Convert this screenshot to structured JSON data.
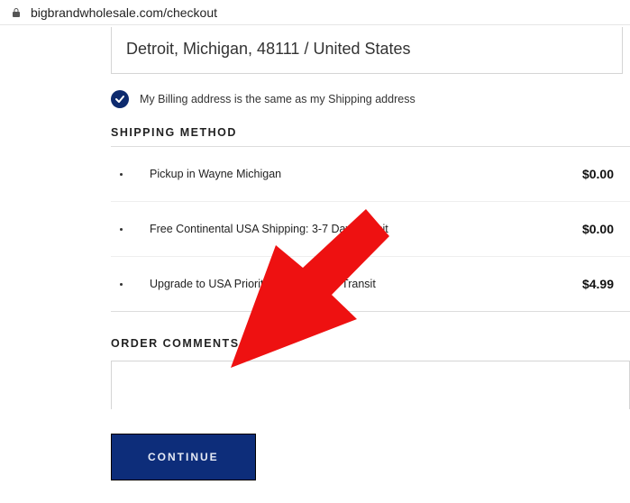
{
  "url": "bigbrandwholesale.com/checkout",
  "address_line": "Detroit, Michigan, 48111 / United States",
  "billing_same_label": "My Billing address is the same as my Shipping address",
  "shipping_heading": "SHIPPING METHOD",
  "shipping_options": [
    {
      "label": "Pickup in Wayne Michigan",
      "price": "$0.00"
    },
    {
      "label": "Free Continental USA Shipping: 3-7 Day Transit",
      "price": "$0.00"
    },
    {
      "label": "Upgrade to USA Priority Mail: 2-3 Day Transit",
      "price": "$4.99"
    }
  ],
  "order_comments_heading": "ORDER COMMENTS",
  "order_comments_value": "",
  "continue_label": "CONTINUE"
}
